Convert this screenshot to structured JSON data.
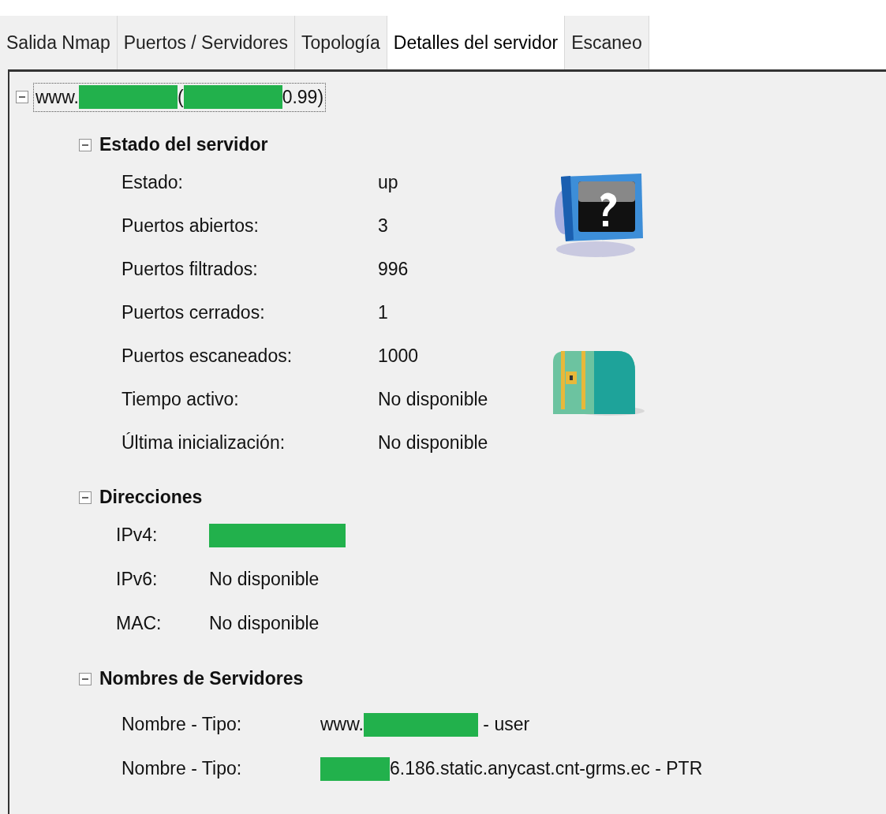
{
  "tabs": [
    {
      "label": "Salida Nmap",
      "selected": false
    },
    {
      "label": "Puertos / Servidores",
      "selected": false
    },
    {
      "label": "Topología",
      "selected": false
    },
    {
      "label": "Detalles del servidor",
      "selected": true
    },
    {
      "label": "Escaneo",
      "selected": false
    }
  ],
  "host": {
    "expanded": true,
    "segments": [
      {
        "kind": "text",
        "text": "www."
      },
      {
        "kind": "redacted"
      },
      {
        "kind": "text",
        "text": "("
      },
      {
        "kind": "redacted"
      },
      {
        "kind": "text",
        "text": "0.99)"
      }
    ]
  },
  "sections": [
    {
      "title": "Estado del servidor",
      "kind": "status",
      "expanded": true,
      "rows": [
        {
          "label": "Estado:",
          "value": [
            {
              "kind": "text",
              "text": "up"
            }
          ]
        },
        {
          "label": "Puertos abiertos:",
          "value": [
            {
              "kind": "text",
              "text": "3"
            }
          ]
        },
        {
          "label": "Puertos filtrados:",
          "value": [
            {
              "kind": "text",
              "text": "996"
            }
          ]
        },
        {
          "label": "Puertos cerrados:",
          "value": [
            {
              "kind": "text",
              "text": "1"
            }
          ]
        },
        {
          "label": "Puertos escaneados:",
          "value": [
            {
              "kind": "text",
              "text": "1000"
            }
          ]
        },
        {
          "label": "Tiempo activo:",
          "value": [
            {
              "kind": "text",
              "text": "No disponible"
            }
          ]
        },
        {
          "label": "Última inicialización:",
          "value": [
            {
              "kind": "text",
              "text": "No disponible"
            }
          ]
        }
      ]
    },
    {
      "title": "Direcciones",
      "kind": "addresses",
      "expanded": true,
      "rows": [
        {
          "label": "IPv4:",
          "value": [
            {
              "kind": "redacted"
            }
          ]
        },
        {
          "label": "IPv6:",
          "value": [
            {
              "kind": "text",
              "text": "No disponible"
            }
          ]
        },
        {
          "label": "MAC:",
          "value": [
            {
              "kind": "text",
              "text": "No disponible"
            }
          ]
        }
      ]
    },
    {
      "title": "Nombres de Servidores",
      "kind": "names",
      "expanded": true,
      "rows": [
        {
          "label": "Nombre - Tipo:",
          "value": [
            {
              "kind": "text",
              "text": "www."
            },
            {
              "kind": "redacted"
            },
            {
              "kind": "text",
              "text": " - user"
            }
          ]
        },
        {
          "label": "Nombre - Tipo:",
          "value": [
            {
              "kind": "redacted"
            },
            {
              "kind": "text",
              "text": "6.186.static.anycast.cnt-grms.ec - PTR"
            }
          ]
        }
      ]
    }
  ]
}
